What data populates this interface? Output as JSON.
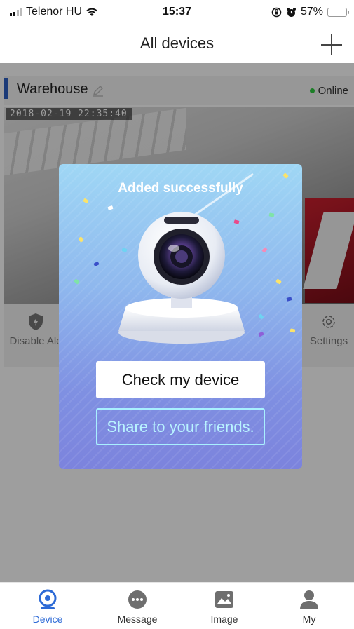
{
  "status_bar": {
    "carrier": "Telenor HU",
    "time": "15:37",
    "battery": "57%",
    "battery_level": 0.57
  },
  "nav": {
    "title": "All devices"
  },
  "device": {
    "name": "Warehouse",
    "status": "Online",
    "timestamp": "2018-02-19  22:35:40"
  },
  "controls": {
    "disable_alert": "Disable Ale",
    "settings": "Settings"
  },
  "modal": {
    "title": "Added successfully",
    "check_label": "Check my device",
    "share_label": "Share to your friends."
  },
  "tabs": [
    {
      "label": "Device",
      "icon": "device-icon",
      "active": true
    },
    {
      "label": "Message",
      "icon": "message-icon",
      "active": false
    },
    {
      "label": "Image",
      "icon": "image-icon",
      "active": false
    },
    {
      "label": "My",
      "icon": "user-icon",
      "active": false
    }
  ],
  "colors": {
    "accent": "#2d6ad6",
    "online": "#2ecc40",
    "device_bar": "#2d5ec2"
  }
}
